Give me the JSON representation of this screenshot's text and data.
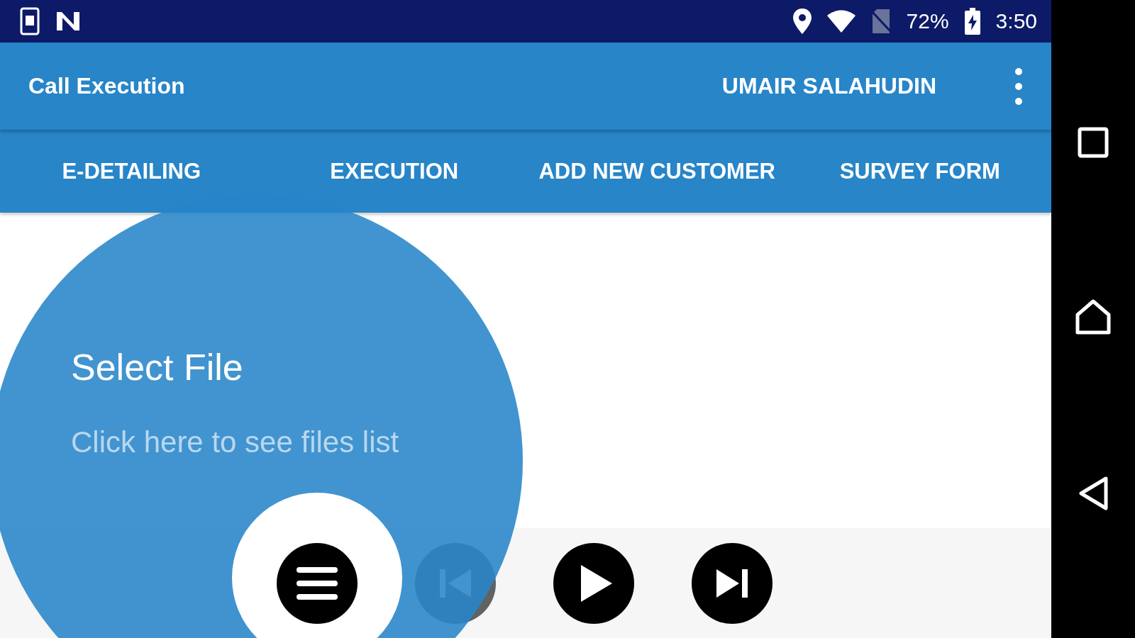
{
  "status_bar": {
    "battery": "72%",
    "time": "3:50"
  },
  "app_bar": {
    "title": "Call Execution",
    "user": "UMAIR SALAHUDIN"
  },
  "tabs": [
    {
      "label": "E-DETAILING"
    },
    {
      "label": "EXECUTION"
    },
    {
      "label": "ADD NEW CUSTOMER"
    },
    {
      "label": "SURVEY FORM"
    }
  ],
  "showcase": {
    "title": "Select File",
    "text": "Click here to see files list"
  },
  "media_controls": [
    {
      "kind": "menu",
      "disabled": false
    },
    {
      "kind": "previous",
      "disabled": true
    },
    {
      "kind": "play",
      "disabled": false
    },
    {
      "kind": "next",
      "disabled": false
    }
  ]
}
